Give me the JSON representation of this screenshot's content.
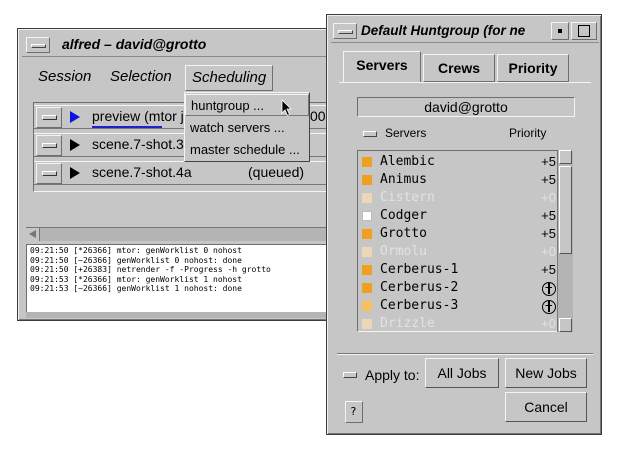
{
  "alfred": {
    "title": "alfred – david@grotto",
    "menu": [
      "Session",
      "Selection",
      "Scheduling"
    ],
    "jobs": [
      {
        "name": "preview (mtor j",
        "status": "00",
        "active": true
      },
      {
        "name": "scene.7-shot.3",
        "status": "",
        "active": false
      },
      {
        "name": "scene.7-shot.4a",
        "status": "(queued)",
        "active": false
      }
    ],
    "log": [
      "09:21:50 [*26366] mtor: genWorklist 0 nohost",
      "09:21:50 [~26366] genWorklist 0 nohost: done",
      "09:21:50 [+26383] netrender -f -Progress -h grotto",
      "09:21:53 [*26366] mtor: genWorklist 1 nohost",
      "09:21:53 [~26366] genWorklist 1 nohost: done"
    ],
    "dropdown": [
      "huntgroup ...",
      "watch servers ...",
      "master schedule ..."
    ]
  },
  "hunt": {
    "title": "Default Huntgroup (for ne",
    "tabs": [
      "Servers",
      "Crews",
      "Priority"
    ],
    "user": "david@grotto",
    "col_servers": "Servers",
    "col_priority": "Priority",
    "servers": [
      {
        "name": "Alembic",
        "priority": "+5",
        "state": "on",
        "enabled": true
      },
      {
        "name": "Animus",
        "priority": "+5",
        "state": "on",
        "enabled": true
      },
      {
        "name": "Cistern",
        "priority": "+0",
        "state": "dim",
        "enabled": false
      },
      {
        "name": "Codger",
        "priority": "+5",
        "state": "off",
        "enabled": true
      },
      {
        "name": "Grotto",
        "priority": "+5",
        "state": "on",
        "enabled": true
      },
      {
        "name": "Ormolu",
        "priority": "+0",
        "state": "dim",
        "enabled": false
      },
      {
        "name": "Cerberus-1",
        "priority": "+5",
        "state": "on",
        "enabled": true
      },
      {
        "name": "Cerberus-2",
        "priority": "peace",
        "state": "on",
        "enabled": true
      },
      {
        "name": "Cerberus-3",
        "priority": "peace",
        "state": "onlight",
        "enabled": true
      },
      {
        "name": "Drizzle",
        "priority": "+0",
        "state": "dim",
        "enabled": false
      }
    ],
    "apply_label": "Apply to:",
    "all_jobs": "All Jobs",
    "new_jobs": "New Jobs",
    "cancel": "Cancel",
    "help_glyph": "?",
    "colors": {
      "server_on": "#f0a020",
      "progress": "#2020d0",
      "play_active": "#1010e0"
    }
  }
}
